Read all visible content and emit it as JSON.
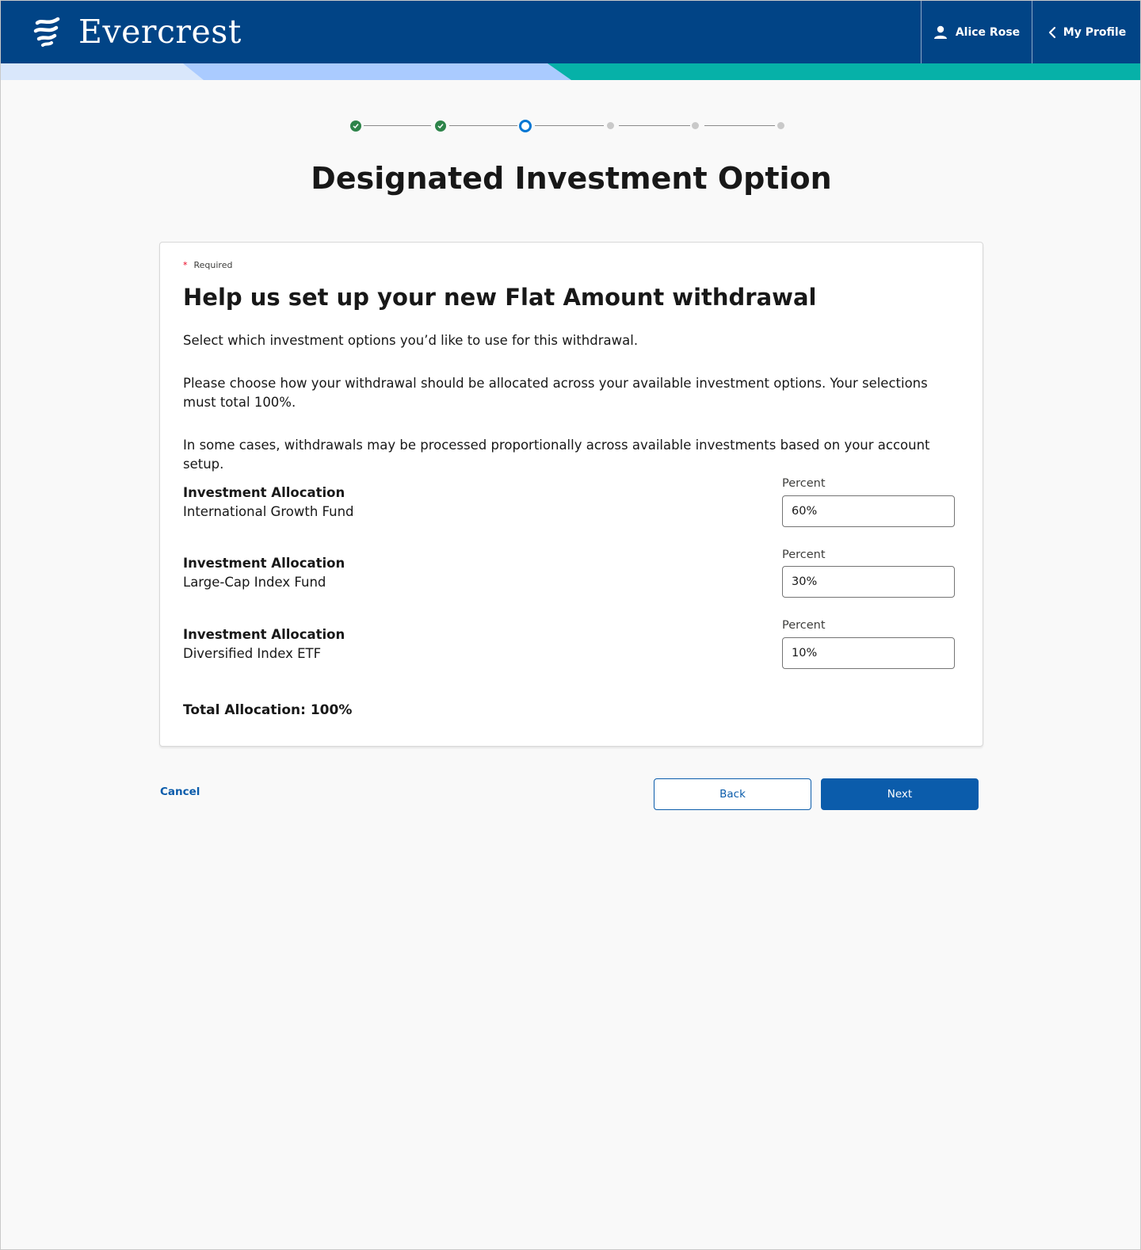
{
  "header": {
    "brand_name": "Evercrest",
    "user_name": "Alice Rose",
    "profile_link": "My Profile",
    "background_color": "#014486"
  },
  "stepper": {
    "completed_steps": 2,
    "current_step": 3,
    "total_steps": 6
  },
  "page_title": "Designated Investment Option",
  "form": {
    "required_marker": "*",
    "required_label": "Required",
    "heading": "Help us set up your new Flat Amount withdrawal",
    "intro": "Select which investment options you’d like to use for this withdrawal.",
    "instructions": "Please choose how your withdrawal should be allocated across your available investment options. Your selections must total 100%.",
    "note": "In some cases, withdrawals may be processed proportionally across available investments based on your account setup.",
    "allocations": [
      {
        "label": "Investment Allocation",
        "fund": "International Growth Fund",
        "percent_label": "Percent",
        "value": "60%"
      },
      {
        "label": "Investment Allocation",
        "fund": "Large-Cap Index Fund",
        "percent_label": "Percent",
        "value": "30%"
      },
      {
        "label": "Investment Allocation",
        "fund": "Diversified Index ETF",
        "percent_label": "Percent",
        "value": "10%"
      }
    ],
    "total": "Total Allocation: 100%"
  },
  "actions": {
    "cancel": "Cancel",
    "back": "Back",
    "next": "Next"
  },
  "colors": {
    "primary": "#0b5cab",
    "step_done": "#2e844a",
    "step_current": "#0176d3",
    "stripe_light": "#d9e7fb",
    "stripe_mid": "#aacbff",
    "stripe_teal": "#06b1a8"
  }
}
